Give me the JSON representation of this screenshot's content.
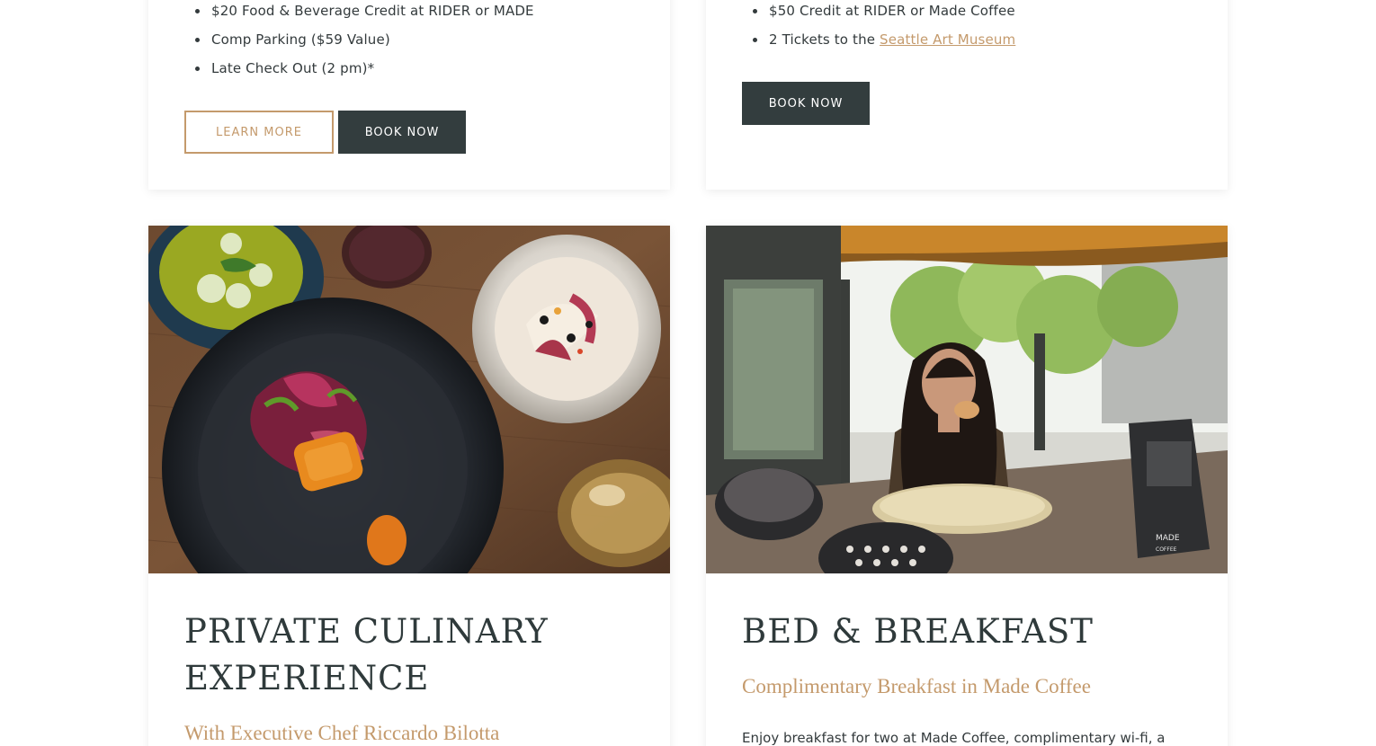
{
  "cards": {
    "top_left": {
      "perks": [
        "$20 Food & Beverage Credit at RIDER or MADE",
        "Comp Parking ($59 Value)",
        "Late Check Out (2 pm)*"
      ],
      "learn_more_label": "LEARN MORE",
      "book_now_label": "BOOK NOW"
    },
    "top_right": {
      "perk_1": "$50 Credit at RIDER or Made Coffee",
      "perk_2_prefix": "2 Tickets to the ",
      "perk_2_link": "Seattle Art Museum",
      "book_now_label": "BOOK NOW"
    },
    "bottom_left": {
      "image_icon": "plated-dish-photo",
      "title": "PRIVATE CULINARY EXPERIENCE",
      "subtitle": "With Executive Chef Riccardo Bilotta"
    },
    "bottom_right": {
      "image_icon": "cafe-patio-photo",
      "title": "BED & BREAKFAST",
      "subtitle": "Complimentary Breakfast in Made Coffee",
      "body": "Enjoy breakfast for two at Made Coffee, complimentary wi-fi, a",
      "sign_text_1": "MADE",
      "sign_text_2": "COFFEE"
    }
  },
  "colors": {
    "accent": "#c49a6c",
    "dark_button": "#333d3e",
    "text": "#333a3c"
  }
}
